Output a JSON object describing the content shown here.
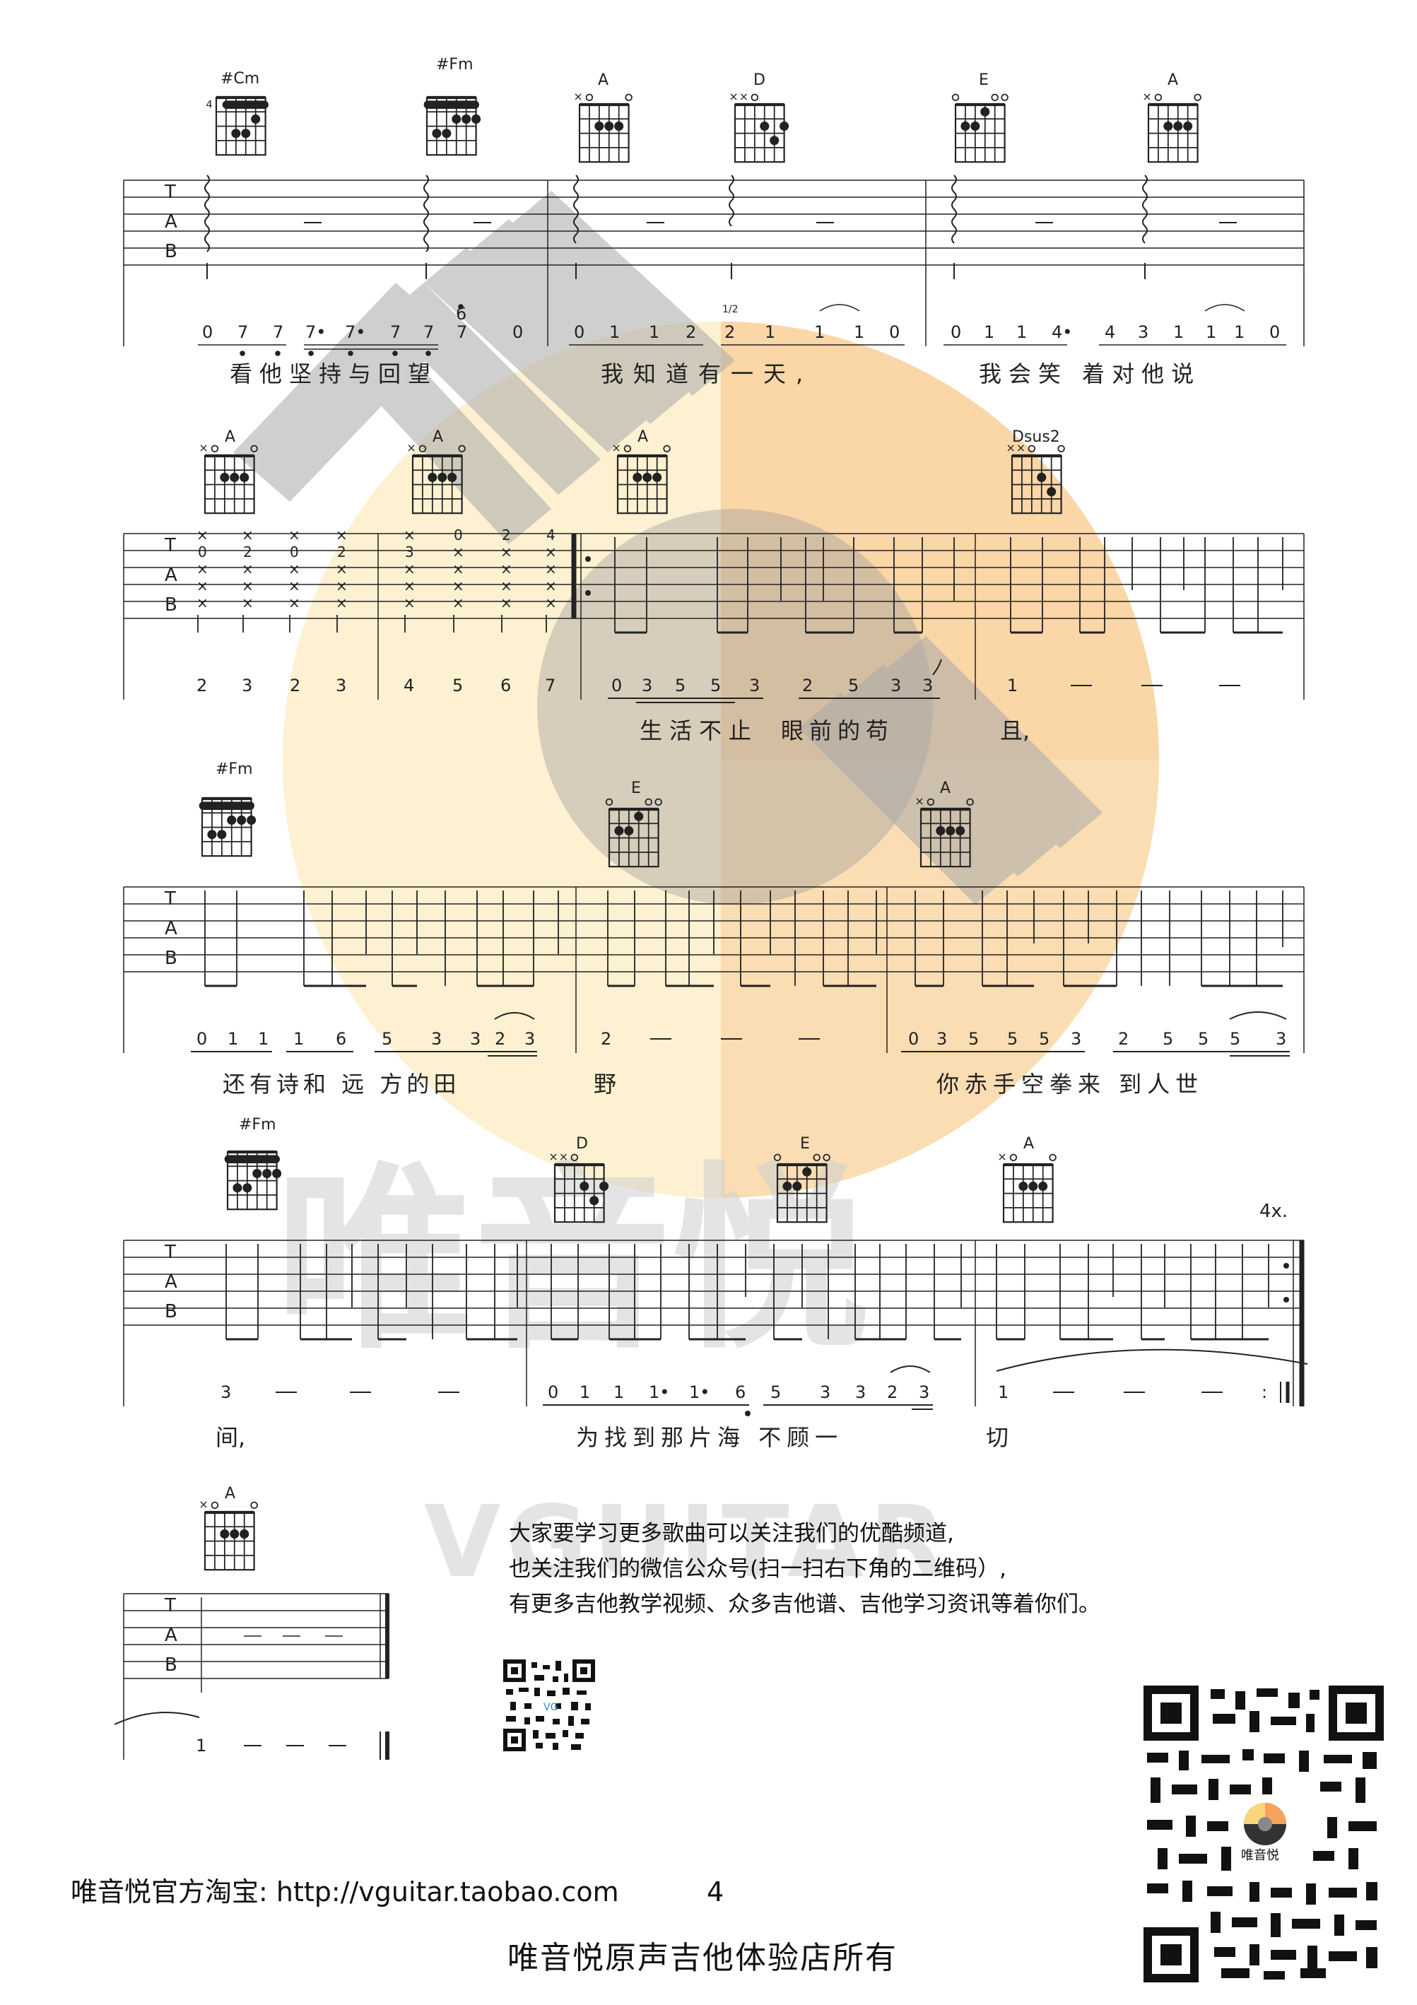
{
  "page_number": "4",
  "colors": {
    "ink": "#222222",
    "watermark_gray": "#cfcfcf",
    "watermark_orange": "#f6a25a",
    "watermark_yellow": "#f8d77a"
  },
  "watermark": {
    "brand_cn": "唯音悦",
    "brand_en": "VGUITAR"
  },
  "systems": [
    {
      "chords": [
        "#Cm",
        "#Fm",
        "A",
        "D",
        "E",
        "A"
      ],
      "chord_fret_marker": "4",
      "numbers": [
        "0",
        "7",
        "7",
        "7•",
        "7•",
        "7",
        "7",
        "7",
        "6",
        "0",
        "0",
        "1",
        "1",
        "2",
        "1/2",
        "2",
        "1",
        "1",
        "1",
        "0",
        "0",
        "1",
        "1",
        "4•",
        "4",
        "3",
        "1",
        "1",
        "1",
        "0"
      ],
      "lyrics": [
        "看他坚持与回望",
        "我知道有一天,",
        "我会笑  着对他说"
      ]
    },
    {
      "chords": [
        "A",
        "A",
        "A",
        "Dsus2"
      ],
      "tab_frets": [
        "0",
        "2",
        "0",
        "2",
        "3",
        "0",
        "2",
        "4"
      ],
      "numbers": [
        "2",
        "3",
        "2",
        "3",
        "4",
        "5",
        "6",
        "7",
        "0",
        "3",
        "5",
        "5",
        "3",
        "2",
        "5",
        "3",
        "3",
        "1"
      ],
      "lyrics": [
        "生活不止",
        "眼前的苟",
        "且,"
      ]
    },
    {
      "chords": [
        "#Fm",
        "E",
        "A"
      ],
      "numbers": [
        "0",
        "1",
        "1",
        "1",
        "6",
        "5",
        "3",
        "3",
        "2",
        "3",
        "2",
        "0",
        "3",
        "5",
        "5",
        "5",
        "3",
        "2",
        "5",
        "5",
        "5",
        "3"
      ],
      "lyrics": [
        "还有诗和 远 方的田",
        "野",
        "你赤手空拳来 到人世"
      ]
    },
    {
      "chords": [
        "#Fm",
        "D",
        "E",
        "A"
      ],
      "repeat_label": "4x.",
      "numbers": [
        "3",
        "0",
        "1",
        "1",
        "1•",
        "1•",
        "6",
        "5",
        "3",
        "3",
        "2",
        "3",
        "1"
      ],
      "lyrics": [
        "间,",
        "为找到那片海 不顾一",
        "切"
      ]
    },
    {
      "chords": [
        "A"
      ],
      "numbers": [
        "1"
      ]
    }
  ],
  "promo_lines": [
    "大家要学习更多歌曲可以关注我们的优酷频道,",
    "也关注我们的微信公众号(扫一扫右下角的二维码）,",
    "有更多吉他教学视频、众多吉他谱、吉他学习资讯等着你们。"
  ],
  "qr_small_label": "VG",
  "qr_large_label": "唯音悦",
  "footer": {
    "shop": "唯音悦官方淘宝:   http://vguitar.taobao.com",
    "bottom": "唯音悦原声吉他体验店所有"
  }
}
